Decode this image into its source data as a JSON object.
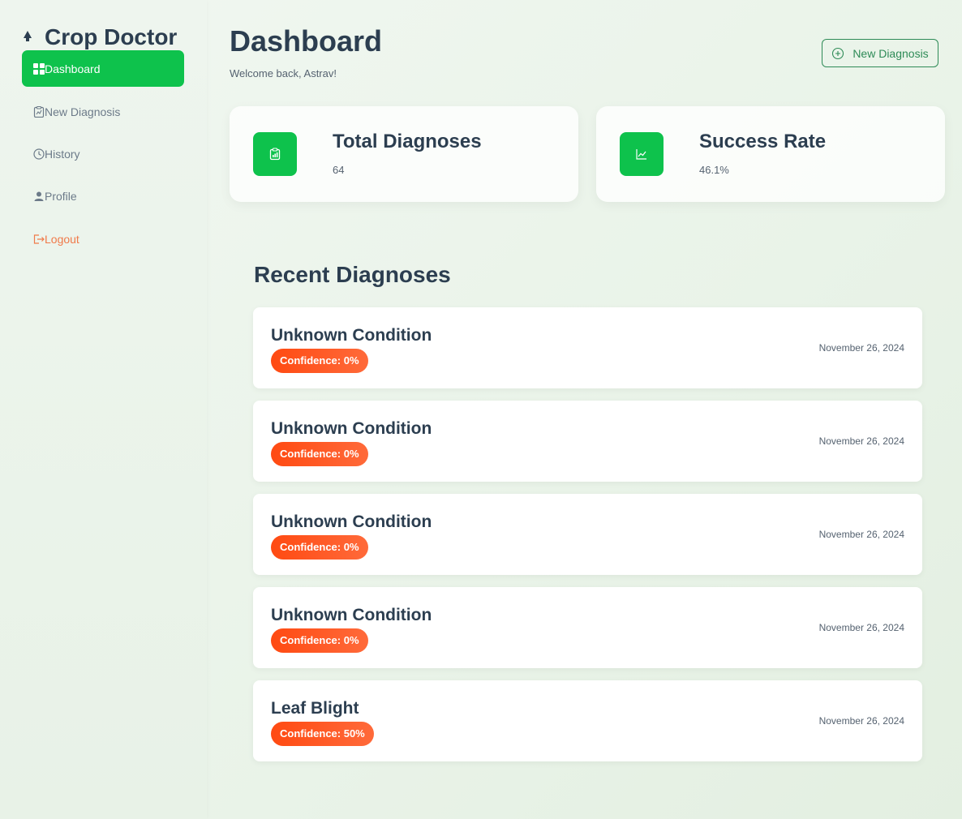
{
  "app": {
    "title": "Crop Doctor",
    "logo_icon": "tree-icon"
  },
  "sidebar": {
    "items": [
      {
        "label": "Dashboard",
        "icon": "grid-icon",
        "active": true
      },
      {
        "label": "New Diagnosis",
        "icon": "clipboard-icon",
        "active": false
      },
      {
        "label": "History",
        "icon": "clock-icon",
        "active": false
      },
      {
        "label": "Profile",
        "icon": "user-icon",
        "active": false
      },
      {
        "label": "Logout",
        "icon": "logout-icon",
        "active": false
      }
    ]
  },
  "header": {
    "title": "Dashboard",
    "welcome": "Welcome back, Astrav!",
    "new_diagnosis_label": "New Diagnosis",
    "new_diagnosis_icon": "plus-circle-icon"
  },
  "stats": [
    {
      "label": "Total Diagnoses",
      "value": "64",
      "icon": "clipboard-chart-icon"
    },
    {
      "label": "Success Rate",
      "value": "46.1%",
      "icon": "line-chart-icon"
    }
  ],
  "recent": {
    "title": "Recent Diagnoses",
    "items": [
      {
        "name": "Unknown Condition",
        "confidence": "Confidence: 0%",
        "date": "November 26, 2024"
      },
      {
        "name": "Unknown Condition",
        "confidence": "Confidence: 0%",
        "date": "November 26, 2024"
      },
      {
        "name": "Unknown Condition",
        "confidence": "Confidence: 0%",
        "date": "November 26, 2024"
      },
      {
        "name": "Unknown Condition",
        "confidence": "Confidence: 0%",
        "date": "November 26, 2024"
      },
      {
        "name": "Leaf Blight",
        "confidence": "Confidence: 50%",
        "date": "November 26, 2024"
      }
    ]
  },
  "colors": {
    "accent": "#0ec24c",
    "outline_button": "#2e8b57",
    "badge": "#ff4a12",
    "logout": "#f07a4a"
  }
}
